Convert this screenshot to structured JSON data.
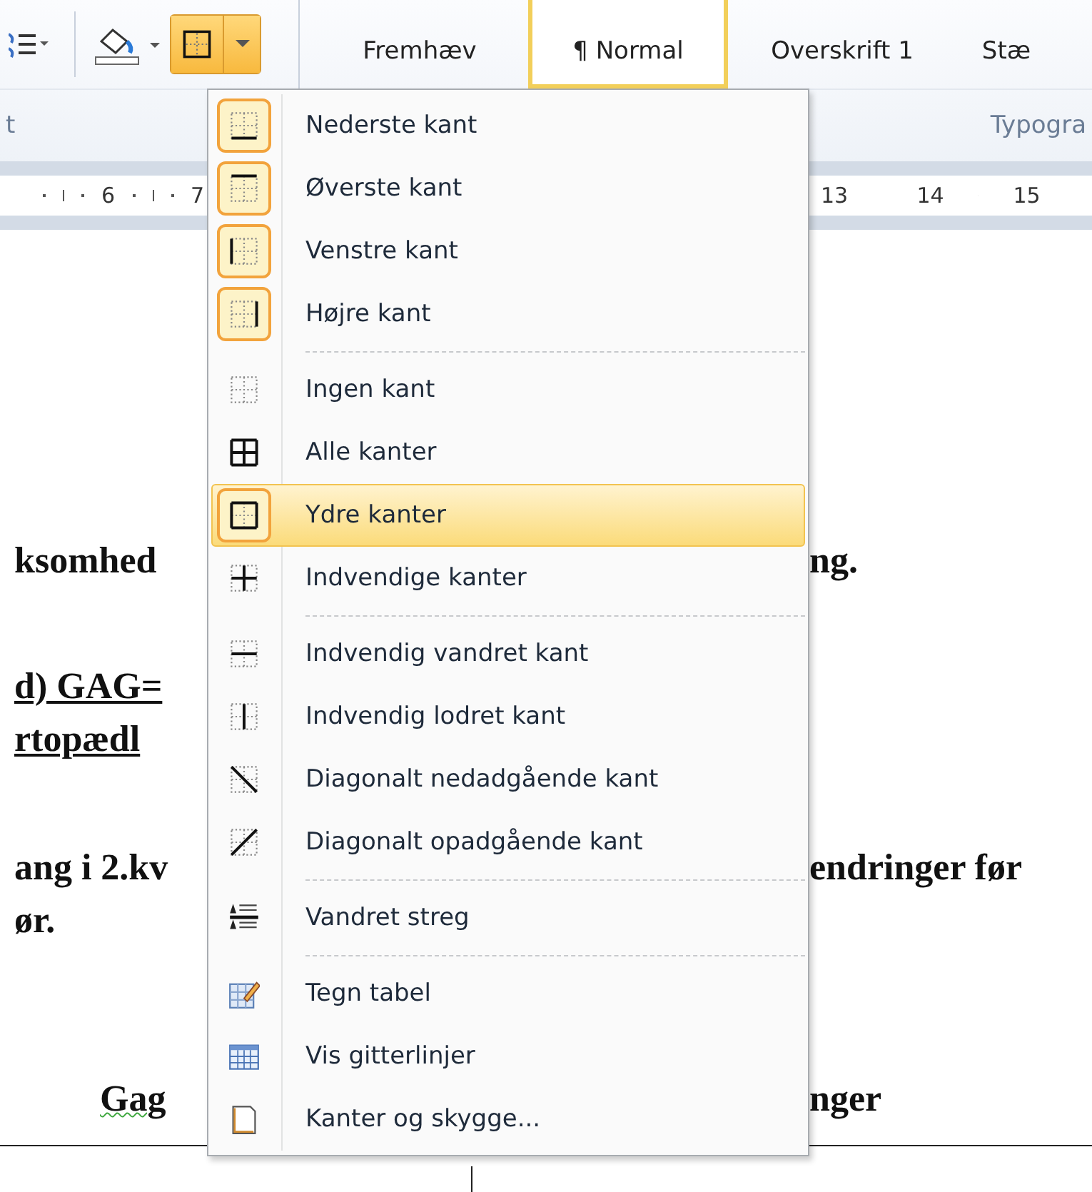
{
  "ribbon": {
    "borders_button": {
      "pressed": true
    },
    "styles": [
      {
        "label": "Fremhæv",
        "selected": false
      },
      {
        "label": "¶ Normal",
        "selected": true
      },
      {
        "label": "Overskrift 1",
        "selected": false
      },
      {
        "label": "Stæ",
        "selected": false
      }
    ],
    "group_labels": [
      "t",
      "Typogra"
    ]
  },
  "ruler": {
    "left_numbers": [
      "6",
      "7"
    ],
    "right_numbers": [
      "13",
      "14",
      "15"
    ]
  },
  "document": {
    "lines": [
      {
        "left": "ksomhed",
        "right": "ng.",
        "underlined": false,
        "misspelled": false
      },
      {
        "left": "d) GAG=",
        "underlined": true,
        "misspelled": false
      },
      {
        "left": "rtopædl",
        "underlined": true,
        "misspelled": false
      },
      {
        "left": "ang i 2.kv",
        "right": "endringer før",
        "underlined": false,
        "misspelled": false
      },
      {
        "left": "ør.",
        "underlined": false,
        "misspelled": false
      },
      {
        "left": "Gag",
        "right": "nger",
        "underlined": false,
        "misspelled": true
      }
    ]
  },
  "menu": {
    "sections": [
      {
        "items": [
          {
            "label": "Nederste kant",
            "checked": true,
            "selected": false
          },
          {
            "label": "Øverste kant",
            "checked": true,
            "selected": false
          },
          {
            "label": "Venstre kant",
            "checked": true,
            "selected": false
          },
          {
            "label": "Højre kant",
            "checked": true,
            "selected": false
          }
        ]
      },
      {
        "items": [
          {
            "label": "Ingen kant",
            "checked": false,
            "selected": false
          },
          {
            "label": "Alle kanter",
            "checked": false,
            "selected": false
          },
          {
            "label": "Ydre kanter",
            "checked": true,
            "selected": true
          },
          {
            "label": "Indvendige kanter",
            "checked": false,
            "selected": false
          }
        ]
      },
      {
        "items": [
          {
            "label": "Indvendig vandret kant",
            "checked": false,
            "selected": false
          },
          {
            "label": "Indvendig lodret kant",
            "checked": false,
            "selected": false
          },
          {
            "label": "Diagonalt nedadgående kant",
            "checked": false,
            "selected": false
          },
          {
            "label": "Diagonalt opadgående kant",
            "checked": false,
            "selected": false
          }
        ]
      },
      {
        "items": [
          {
            "label": "Vandret streg",
            "checked": false,
            "selected": false
          }
        ]
      },
      {
        "items": [
          {
            "label": "Tegn tabel",
            "checked": false,
            "selected": false
          },
          {
            "label": "Vis gitterlinjer",
            "checked": false,
            "selected": false
          },
          {
            "label": "Kanter og skygge...",
            "checked": false,
            "selected": false
          }
        ]
      }
    ]
  }
}
